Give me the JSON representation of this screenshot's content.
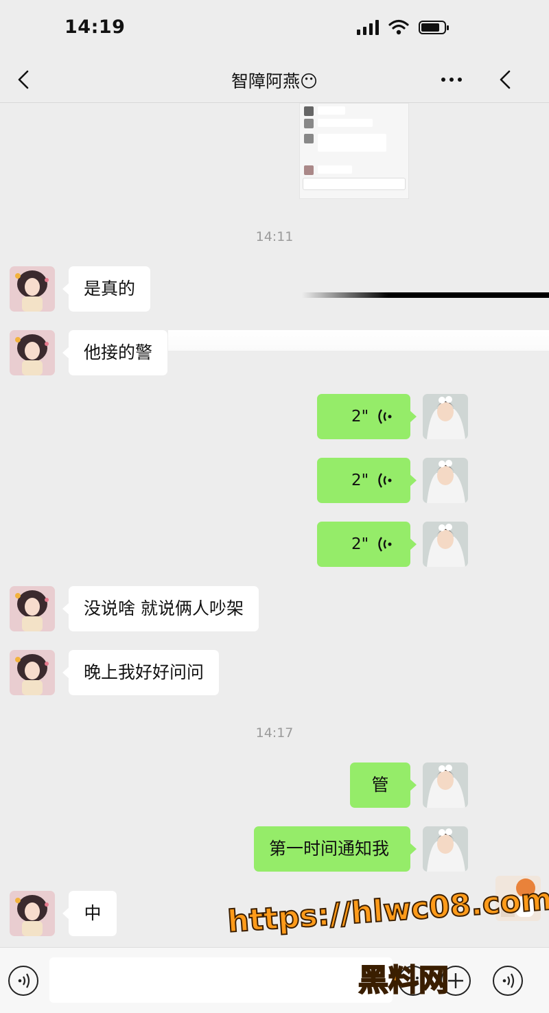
{
  "status_bar": {
    "time": "14:19",
    "battery_level": 0.8
  },
  "nav": {
    "title": "智障阿燕😶"
  },
  "timestamps": [
    "14:11",
    "14:17"
  ],
  "messages": [
    {
      "side": "in",
      "type": "text",
      "text": "是真的"
    },
    {
      "side": "in",
      "type": "text",
      "text": "他接的警"
    },
    {
      "side": "out",
      "type": "voice",
      "text": "2\""
    },
    {
      "side": "out",
      "type": "voice",
      "text": "2\""
    },
    {
      "side": "out",
      "type": "voice",
      "text": "2\""
    },
    {
      "side": "in",
      "type": "text",
      "text": "没说啥  就说俩人吵架"
    },
    {
      "side": "in",
      "type": "text",
      "text": "晚上我好好问问"
    },
    {
      "side": "out",
      "type": "text",
      "text": "管"
    },
    {
      "side": "out",
      "type": "text",
      "text": "第一时间通知我"
    },
    {
      "side": "in",
      "type": "text",
      "text": "中"
    }
  ],
  "icons": {
    "back": "chevron-left-icon",
    "more": "more-dots-icon",
    "voice": "voice-wave-icon",
    "emoji": "emoji-icon",
    "add": "plus-icon"
  },
  "colors": {
    "background": "#ededed",
    "incoming_bubble": "#ffffff",
    "outgoing_bubble": "#95ec69",
    "timestamp": "#9a9a9a"
  },
  "watermark": {
    "url": "https://hlwc08.com",
    "name": "黑料网"
  }
}
